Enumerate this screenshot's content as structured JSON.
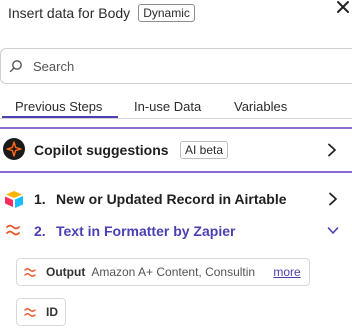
{
  "header": {
    "title": "Insert data for Body",
    "badge": "Dynamic",
    "close_icon": "close-icon"
  },
  "search": {
    "placeholder": "Search",
    "value": ""
  },
  "tabs": [
    {
      "label": "Previous Steps",
      "active": true
    },
    {
      "label": "In-use Data",
      "active": false
    },
    {
      "label": "Variables",
      "active": false
    }
  ],
  "copilot": {
    "label": "Copilot suggestions",
    "badge": "AI beta",
    "icon": "copilot-icon"
  },
  "steps": [
    {
      "number": "1.",
      "title": "New or Updated Record in Airtable",
      "icon": "airtable-icon",
      "expanded": false
    },
    {
      "number": "2.",
      "title": "Text in Formatter by Zapier",
      "icon": "formatter-icon",
      "expanded": true
    }
  ],
  "fields": [
    {
      "label": "Output",
      "value": "Amazon A+ Content, Consultin",
      "more": "more"
    },
    {
      "label": "ID"
    }
  ],
  "colors": {
    "accent": "#4a3fb3",
    "copilot_border": "#8a6bd1",
    "formatter": "#e8572a"
  }
}
